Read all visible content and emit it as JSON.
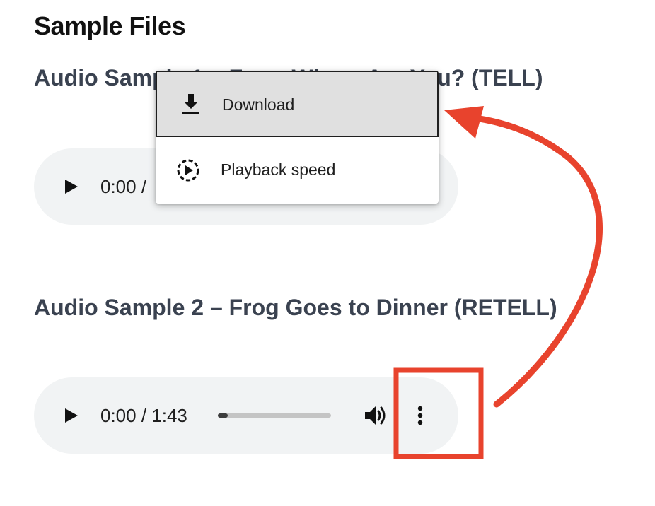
{
  "page": {
    "title": "Sample Files"
  },
  "samples": [
    {
      "heading": "Audio Sample 1 – Frog, Where Are You? (TELL)",
      "player": {
        "time": "0:00 / ",
        "progress": 0
      }
    },
    {
      "heading": "Audio Sample 2 – Frog Goes to Dinner (RETELL)",
      "player": {
        "time": "0:00 / 1:43",
        "progress": 0.08
      }
    }
  ],
  "menu": {
    "items": [
      {
        "label": "Download",
        "icon": "download-icon",
        "highlighted": true
      },
      {
        "label": "Playback speed",
        "icon": "playback-speed-icon",
        "highlighted": false
      }
    ]
  },
  "icons": {
    "play": "play-icon",
    "volume": "volume-icon",
    "more": "more-options-icon"
  },
  "colors": {
    "annotation": "#e8432d",
    "player_background": "#f1f3f4",
    "heading": "#3a4250",
    "menu_highlight": "#e0e0e0"
  }
}
